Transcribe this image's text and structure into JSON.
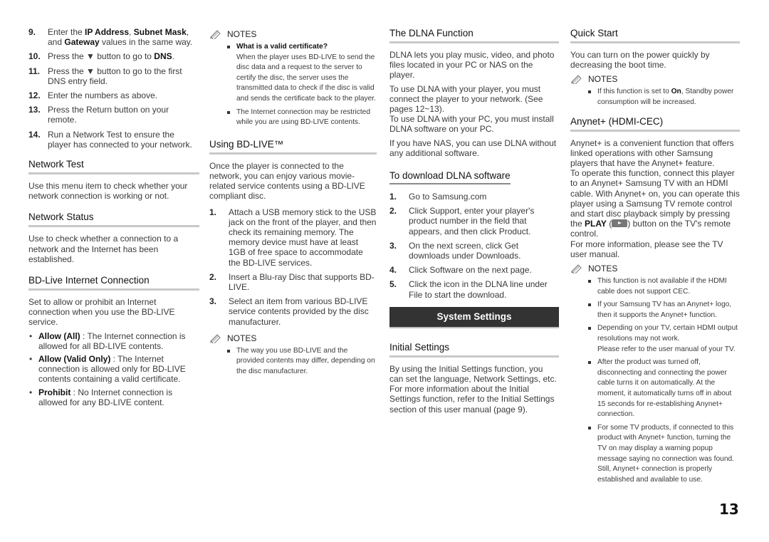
{
  "col1": {
    "steps": [
      {
        "n": "9.",
        "pre": "Enter the ",
        "b1": "IP Address",
        "mid1": ", ",
        "b2": "Subnet Mask",
        "mid2": ", and ",
        "b3": "Gateway",
        "post": " values in the same way."
      },
      {
        "n": "10.",
        "pre": "Press the ▼ button to go to ",
        "b1": "DNS",
        "post": "."
      },
      {
        "n": "11.",
        "text": "Press the ▼ button to go to the first DNS entry field."
      },
      {
        "n": "12.",
        "text": "Enter the numbers as above."
      },
      {
        "n": "13.",
        "text": "Press the Return button on your remote."
      },
      {
        "n": "14.",
        "text": "Run a Network Test to ensure the player has connected to your network."
      }
    ],
    "network_test": {
      "title": "Network Test",
      "body": "Use this menu item to check whether your network connection is working or not."
    },
    "network_status": {
      "title": "Network Status",
      "body": "Use to check whether a connection to a network and the Internet has been established."
    },
    "bdlive_conn": {
      "title": "BD-Live Internet Connection",
      "body": "Set to allow or prohibit an Internet connection when you use the BD-LIVE service.",
      "options": [
        {
          "label": "Allow (All)",
          "text": " : The Internet connection is allowed for all BD-LIVE contents."
        },
        {
          "label": "Allow (Valid Only)",
          "text": " : The Internet connection is allowed only for BD-LIVE contents containing a valid certificate."
        },
        {
          "label": "Prohibit",
          "text": " : No Internet connection is allowed for any BD-LIVE content."
        }
      ]
    }
  },
  "col2": {
    "notes_label": "NOTES",
    "notes1": [
      {
        "bold": "What is a valid certificate?",
        "text": "When the player uses BD-LIVE to send the disc data and a request to the server to certify the disc, the server uses the transmitted data to check if the disc is valid and sends the certificate back to the player."
      },
      {
        "text": "The Internet connection may be restricted while you are using BD-LIVE contents."
      }
    ],
    "using_bdlive": {
      "title": "Using BD-LIVE™",
      "body": "Once the player is connected to the network, you can enjoy various movie-related service contents using a BD-LIVE compliant disc.",
      "steps": [
        {
          "n": "1.",
          "text": "Attach a USB memory stick to the USB jack on the front of the player, and then check its remaining memory. The memory device must have at least 1GB of free space to accommodate the BD-LIVE services."
        },
        {
          "n": "2.",
          "text": "Insert a Blu-ray Disc that supports BD-LIVE."
        },
        {
          "n": "3.",
          "text": "Select an item from various BD-LIVE service contents provided by the disc manufacturer."
        }
      ]
    },
    "notes2": [
      {
        "text": "The way you use BD-LIVE and the provided contents may differ, depending on the disc manufacturer."
      }
    ]
  },
  "col3": {
    "dlna": {
      "title": "The DLNA Function",
      "p1": "DLNA lets you play music, video, and photo files located in your PC or NAS on the player.",
      "p2": "To use DLNA with your player, you must connect the player to your network. (See pages 12~13).",
      "p3": "To use DLNA with your PC, you must install DLNA software on your PC.",
      "p4": "If you have NAS, you can use DLNA without any additional software."
    },
    "download": {
      "title": "To download DLNA software",
      "steps": [
        {
          "n": "1.",
          "text": "Go to Samsung.com"
        },
        {
          "n": "2.",
          "text": "Click Support, enter your player's product number in the field that appears, and then click Product."
        },
        {
          "n": "3.",
          "text": "On the next screen, click Get downloads under Downloads."
        },
        {
          "n": "4.",
          "text": "Click Software on the next page."
        },
        {
          "n": "5.",
          "text": "Click the icon in the DLNA line under File to start the download."
        }
      ]
    },
    "banner": "System Settings",
    "initial": {
      "title": "Initial Settings",
      "p1": "By using the Initial Settings function, you can set the language, Network Settings, etc.",
      "p2": "For more information about the Initial Settings function, refer to the Initial Settings section of this user manual (page 9)."
    }
  },
  "col4": {
    "quick_start": {
      "title": "Quick Start",
      "body": "You can turn on the power quickly by decreasing the boot time.",
      "notes_label": "NOTES",
      "note": {
        "pre": "If this function is set to ",
        "bold": "On",
        "post": ", Standby power consumption will be increased."
      }
    },
    "anynet": {
      "title": "Anynet+ (HDMI-CEC)",
      "p1": "Anynet+ is a convenient function that offers linked operations with other Samsung players that have the Anynet+ feature.",
      "p2a": "To operate this function, connect this player to an Anynet+ Samsung TV with an HDMI cable. With Anynet+ on, you can operate this player using a Samsung TV remote control and start disc playback simply by pressing the ",
      "p2bold": "PLAY",
      "p2b": " button on the TV's remote control.",
      "p3": "For more information, please see the TV user manual.",
      "notes_label": "NOTES",
      "notes": [
        "This function is not available if the HDMI cable does not support CEC.",
        "If your Samsung TV has an Anynet+ logo, then it supports the Anynet+ function.",
        "Depending on your TV, certain HDMI output resolutions may not work.\nPlease refer to the user manual of your TV.",
        "After the product was turned off, disconnecting and connecting the power cable turns it on automatically. At the moment, it automatically turns off in about 15 seconds for re-establishing Anynet+ connection.",
        "For some TV products, if connected to this product with Anynet+ function, turning the TV on may display a warning popup message saying no connection was found. Still, Anynet+ connection is properly established and available to use."
      ]
    }
  },
  "page_number": "13"
}
